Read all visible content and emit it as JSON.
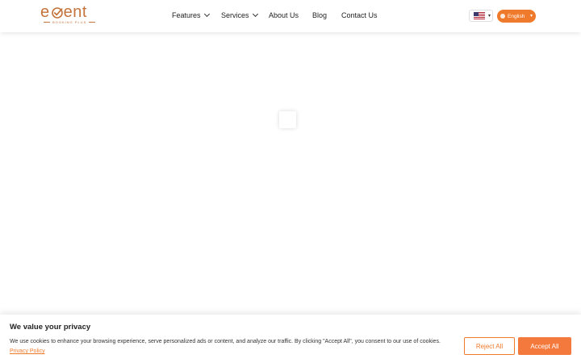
{
  "header": {
    "logo": {
      "word": "event",
      "sub": "BOOKING PLUS"
    },
    "nav": [
      {
        "label": "Features",
        "has_dropdown": true
      },
      {
        "label": "Services",
        "has_dropdown": true
      },
      {
        "label": "About Us",
        "has_dropdown": false
      },
      {
        "label": "Blog",
        "has_dropdown": false
      },
      {
        "label": "Contact Us",
        "has_dropdown": false
      }
    ],
    "flag_select": {
      "icon": "us-flag-icon",
      "caret": "▾"
    },
    "language": {
      "label": "English",
      "caret": "▾"
    }
  },
  "cookie_banner": {
    "title": "We value your privacy",
    "text": "We use cookies to enhance your browsing experience, serve personalized ads or content, and analyze our traffic. By clicking \"Accept All\", you consent to our use of cookies.",
    "link": "Privacy Policy",
    "reject_label": "Reject All",
    "accept_label": "Accept All"
  },
  "colors": {
    "accent": "#f07a2c",
    "logo": "#c4733a"
  }
}
